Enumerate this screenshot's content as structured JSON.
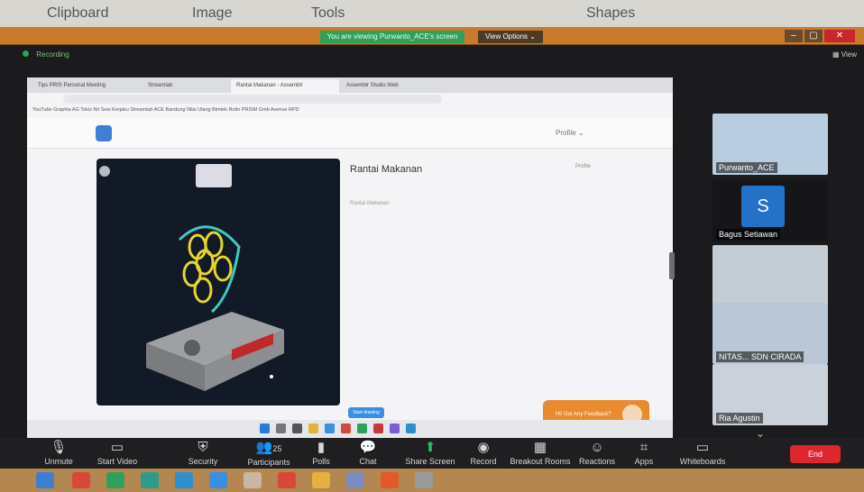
{
  "ribbon": {
    "items": [
      "Clipboard",
      "Image",
      "Tools",
      "Shapes"
    ]
  },
  "sharebar": {
    "viewing_text": "You are viewing Purwanto_ACE's screen",
    "view_options": "View Options ⌄",
    "colors": {
      "bar": "#c97a2a",
      "viewing": "#2fa05a",
      "close": "#c8262c"
    }
  },
  "meeting": {
    "recording_label": "Recording",
    "view_label": "▦ View"
  },
  "browser": {
    "tabs": [
      "Tips PRIS Personal Meeting",
      "Streamlab",
      "Rantai Makanan - Assemblr",
      "Assemblr Studio Web"
    ],
    "url": "",
    "bookmarks": "YouTube  Graphia  AG  Tokiz  Nri  Sesi Kerjaku  Streamlab  ACE Bandung  Nilai Ulang  Bimtek  Rutin PRISM  Gmb  Avenue  RPD"
  },
  "app": {
    "nav": "",
    "avatar": "Profile ⌄",
    "project_title": "Rantai Makanan",
    "subtitle": "",
    "tag": "Rantai Makanan",
    "profile_link": "Profile",
    "feedback": "Hi! Got Any Feedback?",
    "start_drawing": "Start drawing",
    "sort_text": ""
  },
  "participants": [
    {
      "name": "Purwanto_ACE"
    },
    {
      "name": "Bagus Setiawan",
      "initial": "S"
    },
    {
      "name": ""
    },
    {
      "name": "NITAS... SDN CIRADA"
    },
    {
      "name": "Ria Agustin"
    }
  ],
  "toolbar": {
    "unmute": "Unmute",
    "start_video": "Start Video",
    "security": "Security",
    "participants": "Participants",
    "participants_count": "25",
    "polls": "Polls",
    "chat": "Chat",
    "share_screen": "Share Screen",
    "record": "Record",
    "breakout": "Breakout Rooms",
    "reactions": "Reactions",
    "apps": "Apps",
    "whiteboards": "Whiteboards",
    "end": "End"
  }
}
